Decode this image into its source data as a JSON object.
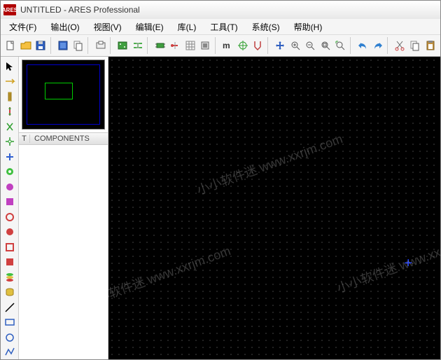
{
  "title": "UNTITLED - ARES Professional",
  "logo_text": "ARES",
  "menu": [
    "文件(F)",
    "输出(O)",
    "视图(V)",
    "编辑(E)",
    "库(L)",
    "工具(T)",
    "系统(S)",
    "帮助(H)"
  ],
  "components_header": {
    "t": "T",
    "label": "COMPONENTS"
  },
  "watermark_text": "小小软件迷  www.xxrjm.com",
  "toolbar_icons": [
    "new-file-icon",
    "open-file-icon",
    "save-icon",
    "sep",
    "import-icon",
    "copy-icon",
    "sep",
    "output-icon",
    "sep",
    "board-icon",
    "netlist-icon",
    "sep",
    "component-icon",
    "pin-icon",
    "grid-icon",
    "package-icon",
    "sep",
    "measure-icon",
    "origin-icon",
    "snap-icon",
    "sep",
    "pan-icon",
    "zoom-in-icon",
    "zoom-out-icon",
    "zoom-fit-icon",
    "zoom-area-icon",
    "sep",
    "undo-icon",
    "redo-icon",
    "sep",
    "cut-icon",
    "copy2-icon",
    "paste-icon"
  ],
  "left_tools": [
    "select-icon",
    "route-icon",
    "track-icon",
    "via-icon",
    "pad-icon",
    "smt-icon",
    "zone-icon",
    "text-icon",
    "dim-icon",
    "marker-icon",
    "ratsnest-icon",
    "fill-icon",
    "arc-icon",
    "circle-icon",
    "rect-icon",
    "rectfill-icon",
    "layers-icon",
    "line-icon",
    "polyline-icon",
    "ellipse-icon"
  ]
}
